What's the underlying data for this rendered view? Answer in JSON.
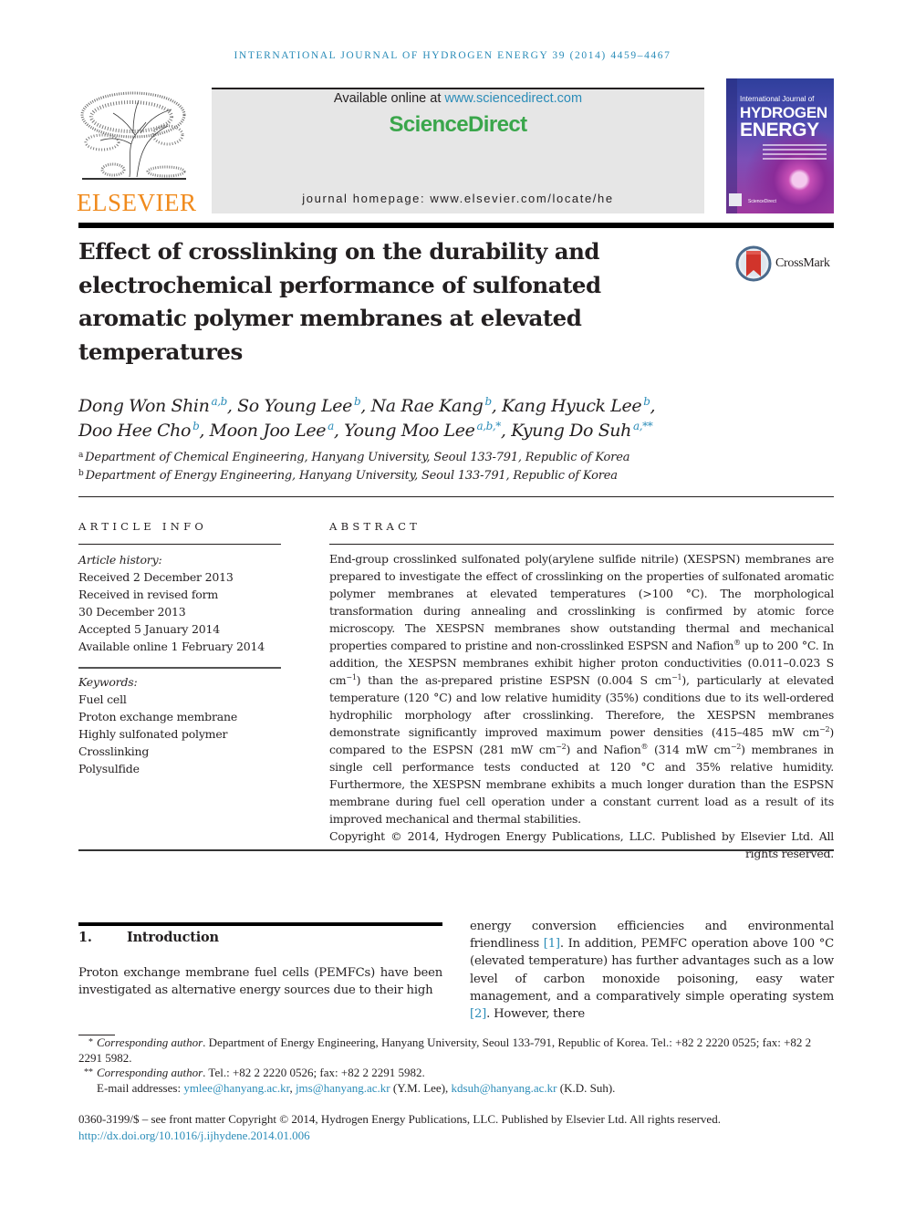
{
  "running_head": "INTERNATIONAL JOURNAL OF HYDROGEN ENERGY 39 (2014) 4459–4467",
  "publisher": {
    "logo_icon": "elsevier-tree-icon",
    "name": "ELSEVIER",
    "brand_color": "#f08a1c"
  },
  "banner": {
    "available_prefix": "Available online at ",
    "available_link": "www.sciencedirect.com",
    "brand": "ScienceDirect",
    "brand_color": "#3aa64b",
    "homepage": "journal homepage: www.elsevier.com/locate/he"
  },
  "cover": {
    "small_line": "International Journal of",
    "title_line1": "HYDROGEN",
    "title_line2": "ENERGY"
  },
  "crossmark": {
    "icon": "crossmark-icon",
    "label": "CrossMark"
  },
  "article": {
    "title": "Effect of crosslinking on the durability and electrochemical performance of sulfonated aromatic polymer membranes at elevated temperatures",
    "authors": [
      {
        "name": "Dong Won Shin",
        "sup": "a,b",
        "sep": ", "
      },
      {
        "name": "So Young Lee",
        "sup": "b",
        "sep": ", "
      },
      {
        "name": "Na Rae Kang",
        "sup": "b",
        "sep": ", "
      },
      {
        "name": "Kang Hyuck Lee",
        "sup": "b",
        "sep": ","
      },
      {
        "name": "Doo Hee Cho",
        "sup": "b",
        "sep": ", "
      },
      {
        "name": "Moon Joo Lee",
        "sup": "a",
        "sep": ", "
      },
      {
        "name": "Young Moo Lee",
        "sup": "a,b,*",
        "sep": ", "
      },
      {
        "name": "Kyung Do Suh",
        "sup": "a,**",
        "sep": ""
      }
    ],
    "affiliations": [
      {
        "mark": "a",
        "text": "Department of Chemical Engineering, Hanyang University, Seoul 133-791, Republic of Korea"
      },
      {
        "mark": "b",
        "text": "Department of Energy Engineering, Hanyang University, Seoul 133-791, Republic of Korea"
      }
    ]
  },
  "article_info": {
    "heading": "ARTICLE INFO",
    "history_label": "Article history:",
    "history": [
      "Received 2 December 2013",
      "Received in revised form",
      "30 December 2013",
      "Accepted 5 January 2014",
      "Available online 1 February 2014"
    ],
    "keywords_label": "Keywords:",
    "keywords": [
      "Fuel cell",
      "Proton exchange membrane",
      "Highly sulfonated polymer",
      "Crosslinking",
      "Polysulfide"
    ]
  },
  "abstract": {
    "heading": "ABSTRACT",
    "parts": {
      "p1": "End-group crosslinked sulfonated poly(arylene sulfide nitrile) (XESPSN) membranes are prepared to investigate the effect of crosslinking on the properties of sulfonated aromatic polymer membranes at elevated temperatures (>100 °C). The morphological transformation during annealing and crosslinking is confirmed by atomic force microscopy. The XESPSN membranes show outstanding thermal and mechanical properties compared to pristine and non-crosslinked ESPSN and Nafion",
      "p2": " up to 200 °C. In addition, the XESPSN membranes exhibit higher proton conductivities (0.011–0.023 S cm",
      "p3": ") than the as-prepared pristine ESPSN (0.004 S cm",
      "p4": "), particularly at elevated temperature (120 °C) and low relative humidity (35%) conditions due to its well-ordered hydrophilic morphology after crosslinking. Therefore, the XESPSN membranes demonstrate significantly improved maximum power densities (415–485 mW cm",
      "p5": ") compared to the ESPSN (281 mW cm",
      "p6": ") and Nafion",
      "p7": " (314 mW cm",
      "p8": ") membranes in single cell performance tests conducted at 120 °C and 35% relative humidity. Furthermore, the XESPSN membrane exhibits a much longer duration than the ESPSN membrane during fuel cell operation under a constant current load as a result of its improved mechanical and thermal stabilities.",
      "reg": "®",
      "minus1": "−1",
      "minus2": "−2"
    },
    "copyright": "Copyright © 2014, Hydrogen Energy Publications, LLC. Published by Elsevier Ltd. All rights reserved."
  },
  "introduction": {
    "number": "1.",
    "heading": "Introduction",
    "left_text": "Proton exchange membrane fuel cells (PEMFCs) have been investigated as alternative energy sources due to their high",
    "right_a": "energy conversion efficiencies and environmental friendliness ",
    "ref1": "[1]",
    "right_b": ". In addition, PEMFC operation above 100 °C (elevated temperature) has further advantages such as a low level of carbon monoxide poisoning, easy water management, and a comparatively simple operating system ",
    "ref2": "[2]",
    "right_c": ". However, there"
  },
  "footnotes": {
    "fn1_mark": "*",
    "fn1_label": "Corresponding author",
    "fn1_text": ". Department of Energy Engineering, Hanyang University, Seoul 133-791, Republic of Korea. Tel.: +82 2 2220 0525; fax: +82 2 2291 5982.",
    "fn2_mark": "**",
    "fn2_label": "Corresponding author",
    "fn2_text": ". Tel.: +82 2 2220 0526; fax: +82 2 2291 5982.",
    "email_label": "E-mail addresses: ",
    "emails": [
      {
        "addr": "ymlee@hanyang.ac.kr",
        "after": ", "
      },
      {
        "addr": "jms@hanyang.ac.kr",
        "after": " (Y.M. Lee), "
      },
      {
        "addr": "kdsuh@hanyang.ac.kr",
        "after": " (K.D. Suh)."
      }
    ]
  },
  "issn_line": "0360-3199/$ – see front matter Copyright © 2014, Hydrogen Energy Publications, LLC. Published by Elsevier Ltd. All rights reserved.",
  "doi_link": "http://dx.doi.org/10.1016/j.ijhydene.2014.01.006",
  "colors": {
    "link": "#2a8cb8",
    "text": "#231f20",
    "banner_bg": "#e6e6e6"
  }
}
